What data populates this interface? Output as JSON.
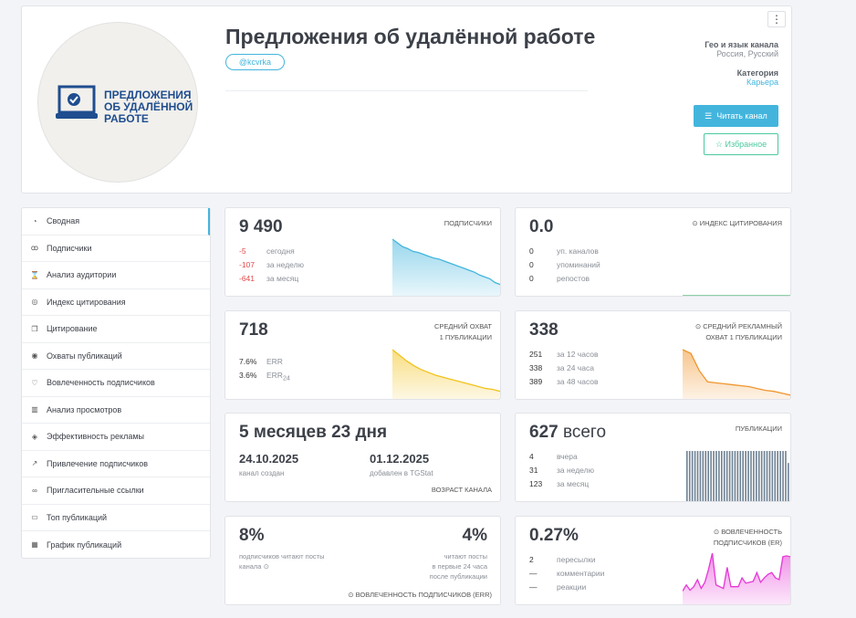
{
  "header": {
    "title": "Предложения об удалённой работе",
    "handle": "@kcvrka",
    "logo_lines": [
      "ПРЕДЛОЖЕНИЯ",
      "ОБ УДАЛЁННОЙ",
      "РАБОТЕ"
    ],
    "menu_icon": "⋮",
    "geo_label": "Гео и язык канала",
    "geo_value": "Россия, Русский",
    "category_label": "Категория",
    "category_value": "Карьера",
    "read_button": "Читать канал",
    "fav_button": "Избранное"
  },
  "sidebar": {
    "items": [
      {
        "label": "Сводная",
        "icon": "◔"
      },
      {
        "label": "Подписчики",
        "icon": "ꝏ"
      },
      {
        "label": "Анализ аудитории",
        "icon": "⌛"
      },
      {
        "label": "Индекс цитирования",
        "icon": "◎"
      },
      {
        "label": "Цитирование",
        "icon": "❐"
      },
      {
        "label": "Охваты публикаций",
        "icon": "◉"
      },
      {
        "label": "Вовлеченность подписчиков",
        "icon": "♡"
      },
      {
        "label": "Анализ просмотров",
        "icon": "▥"
      },
      {
        "label": "Эффективность рекламы",
        "icon": "◈"
      },
      {
        "label": "Привлечение подписчиков",
        "icon": "↗"
      },
      {
        "label": "Пригласительные ссылки",
        "icon": "∞"
      },
      {
        "label": "Топ публикаций",
        "icon": "▭"
      },
      {
        "label": "График публикаций",
        "icon": "▦"
      }
    ]
  },
  "subs": {
    "value": "9 490",
    "label": "ПОДПИСЧИКИ",
    "rows": [
      {
        "n": "-5",
        "d": "сегодня"
      },
      {
        "n": "-107",
        "d": "за неделю"
      },
      {
        "n": "-641",
        "d": "за месяц"
      }
    ],
    "spark": [
      60,
      56,
      52,
      50,
      47,
      46,
      44,
      42,
      40,
      39,
      37,
      35,
      33,
      31,
      29,
      27,
      25,
      22,
      20,
      18,
      14,
      12
    ],
    "color": "#43b5dd"
  },
  "cite": {
    "value": "0.0",
    "label": "ИНДЕКС ЦИТИРОВАНИЯ",
    "rows": [
      {
        "n": "0",
        "d": "уп. каналов"
      },
      {
        "n": "0",
        "d": "упоминаний"
      },
      {
        "n": "0",
        "d": "репостов"
      }
    ]
  },
  "reach": {
    "value": "718",
    "label1": "СРЕДНИЙ ОХВАТ",
    "label2": "1 ПУБЛИКАЦИИ",
    "err": "7.6%",
    "err_label": "ERR",
    "err24": "3.6%",
    "err24_label": "ERR",
    "err24_sub": "24",
    "spark": [
      52,
      46,
      40,
      35,
      31,
      28,
      25,
      23,
      21,
      19,
      17,
      15,
      13,
      11,
      10,
      8
    ],
    "color": "#f2c21b"
  },
  "adreach": {
    "value": "338",
    "label1": "СРЕДНИЙ РЕКЛАМНЫЙ",
    "label2": "ОХВАТ 1 ПУБЛИКАЦИИ",
    "rows": [
      {
        "n": "251",
        "d": "за 12 часов"
      },
      {
        "n": "338",
        "d": "за 24 часа"
      },
      {
        "n": "389",
        "d": "за 48 часов"
      }
    ],
    "spark": [
      52,
      48,
      30,
      18,
      17,
      16,
      15,
      14,
      13,
      11,
      9,
      8,
      6,
      4
    ],
    "color": "#f0962e"
  },
  "age": {
    "value": "5 месяцев 23 дня",
    "created": "24.10.2025",
    "created_label": "канал создан",
    "added": "01.12.2025",
    "added_label": "добавлен в TGStat",
    "label": "ВОЗРАСТ КАНАЛА"
  },
  "posts": {
    "value": "627",
    "value_suffix": "всего",
    "label": "ПУБЛИКАЦИИ",
    "rows": [
      {
        "n": "4",
        "d": "вчера"
      },
      {
        "n": "31",
        "d": "за неделю"
      },
      {
        "n": "123",
        "d": "за месяц"
      }
    ],
    "bars": [
      1,
      1,
      1,
      1,
      1,
      1,
      1,
      1,
      1,
      1,
      1,
      1,
      1,
      1,
      1,
      1,
      1,
      1,
      1,
      1,
      1,
      1,
      1,
      1,
      1,
      1,
      1,
      1,
      1,
      1,
      1,
      1,
      1,
      1,
      1,
      1,
      1,
      1,
      0.76
    ],
    "color": "#6f8294"
  },
  "err": {
    "left_value": "8%",
    "left_sub1": "подписчиков читают посты",
    "left_sub2": "канала",
    "right_value": "4%",
    "right_sub1": "читают посты",
    "right_sub2": "в первые 24 часа",
    "right_sub3": "после публикации",
    "label": "ВОВЛЕЧЕННОСТЬ ПОДПИСЧИКОВ (ERR)"
  },
  "er": {
    "value": "0.27%",
    "label1": "ВОВЛЕЧЕННОСТЬ",
    "label2": "ПОДПИСЧИКОВ (ER)",
    "rows": [
      {
        "n": "2",
        "d": "пересылки"
      },
      {
        "n": "—",
        "d": "комментарии"
      },
      {
        "n": "—",
        "d": "реакции"
      }
    ],
    "spark": [
      15,
      22,
      16,
      20,
      28,
      18,
      25,
      40,
      58,
      22,
      20,
      18,
      42,
      20,
      20,
      20,
      30,
      24,
      25,
      26,
      36,
      25,
      30,
      34,
      36,
      30,
      28,
      54,
      55,
      54
    ],
    "color": "#e636d6"
  }
}
